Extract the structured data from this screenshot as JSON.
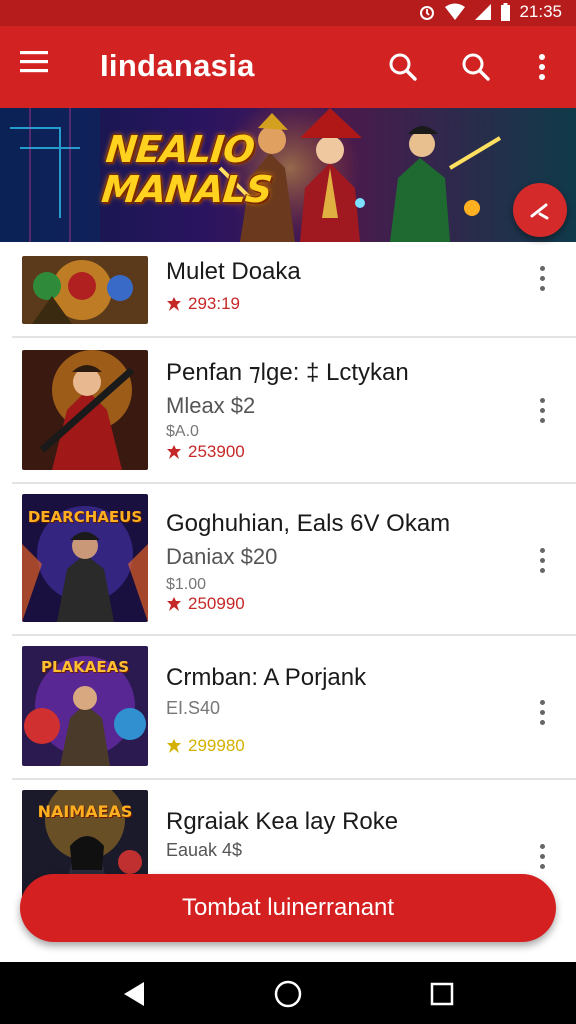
{
  "status_bar": {
    "time": "21:35"
  },
  "app_bar": {
    "title": "Iindanasia",
    "icons": [
      "menu-icon",
      "search-icon",
      "search-icon",
      "more-vert-icon"
    ]
  },
  "banner": {
    "title_line1": "NEALIO",
    "title_line2": "MANALS"
  },
  "share_fab": {
    "icon": "share-icon"
  },
  "items": [
    {
      "title": "Mulet Doaka",
      "count": "293:19",
      "count_color": "#c62828"
    },
    {
      "title": "Penfan ⁊lge: ‡ Lctykan",
      "subtitle": "Mleax $2",
      "price": "$A.0",
      "count": "253900",
      "count_color": "#c62828"
    },
    {
      "title": "Goghuhian, Eals 6V Okam",
      "subtitle": "Daniax $20",
      "price": "$1.00",
      "count": "250990",
      "count_color": "#c62828",
      "thumb_text": "DEARCHAEUS"
    },
    {
      "title": "Crmban: A Porjank",
      "price": "EI.S40",
      "count": "299980",
      "count_color": "#d4b100",
      "thumb_text": "PLAKAEAS"
    },
    {
      "title": "Rgraiak Kea lay Roke",
      "subtitle": "Eauak 4$",
      "thumb_text": "NAIMAEAS"
    }
  ],
  "cta": {
    "label": "Tombat luinerranant"
  },
  "colors": {
    "primary": "#d32222",
    "status": "#b71c1c",
    "accent_yellow": "#d4b100"
  },
  "nav": {
    "icons": [
      "back-icon",
      "home-icon",
      "recents-icon"
    ]
  }
}
